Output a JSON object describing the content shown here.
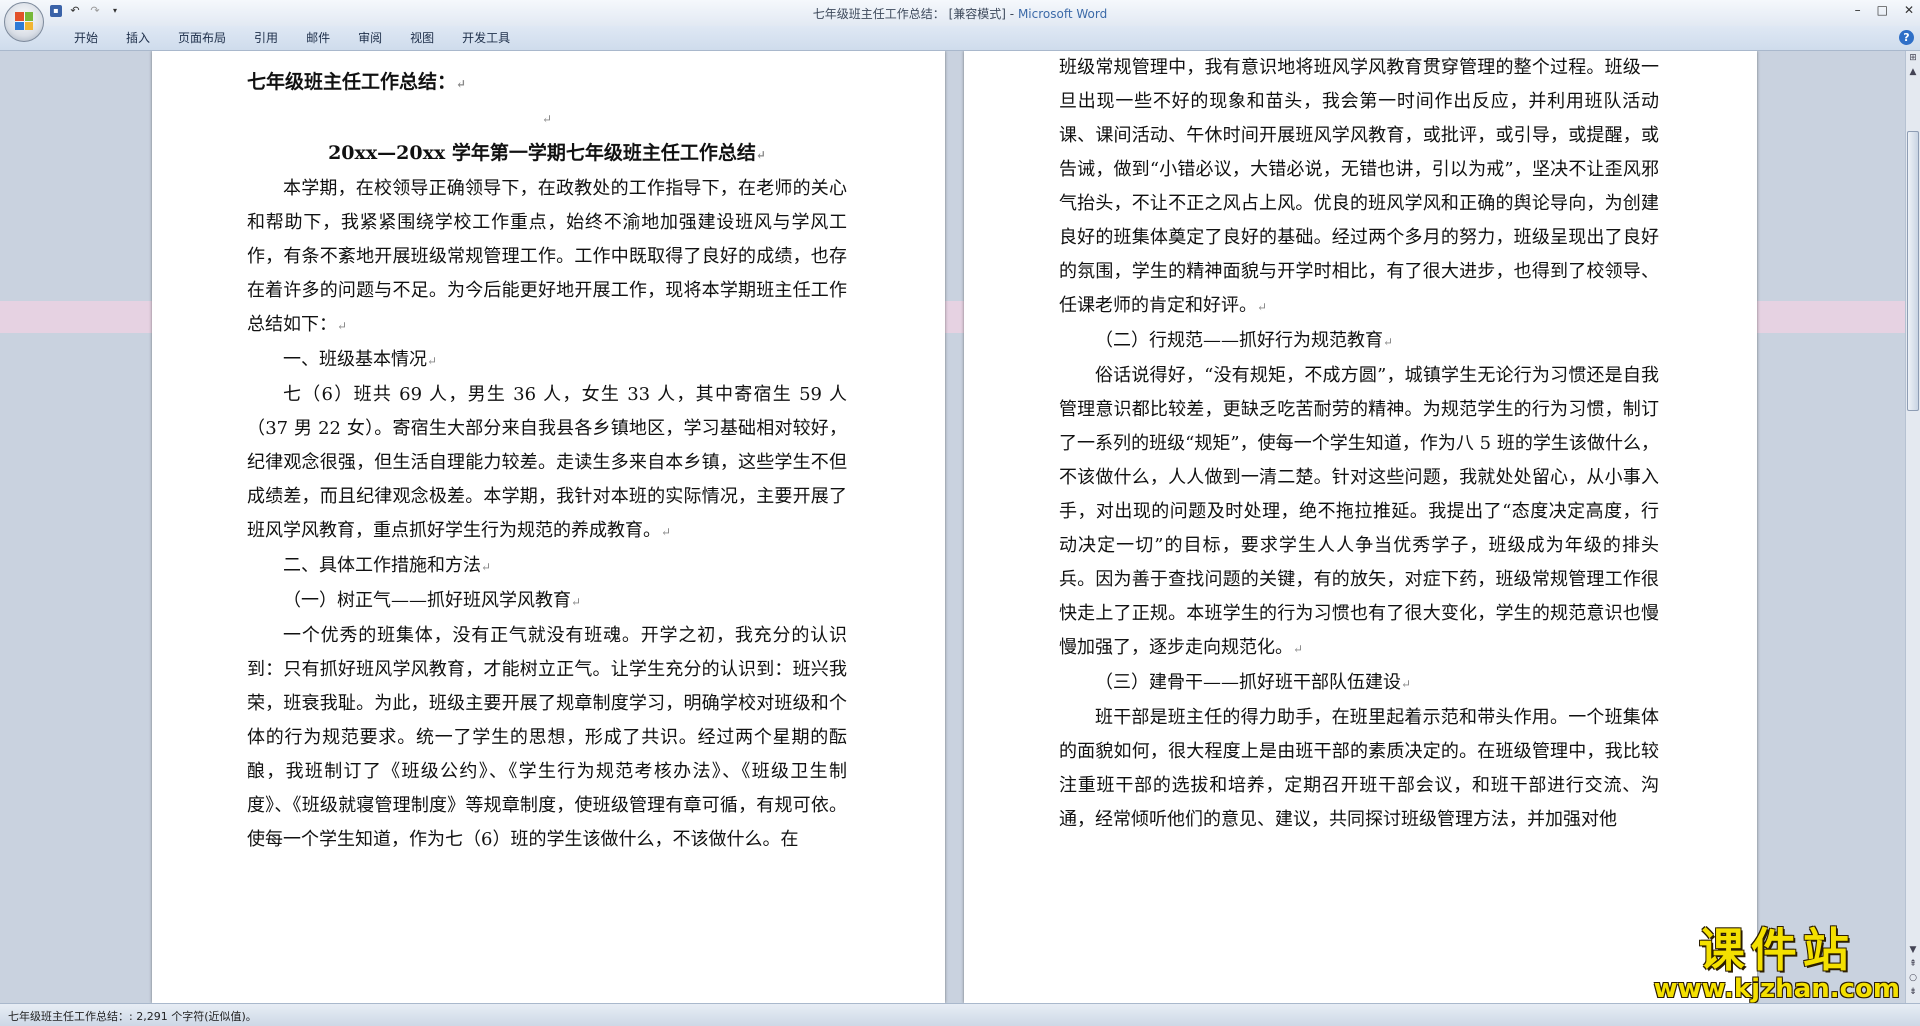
{
  "window": {
    "doc_title": "七年级班主任工作总结：",
    "mode": "[兼容模式]",
    "app": "Microsoft Word"
  },
  "ribbon": {
    "tabs": [
      "开始",
      "插入",
      "页面布局",
      "引用",
      "邮件",
      "审阅",
      "视图",
      "开发工具"
    ]
  },
  "page1": {
    "heading": "七年级班主任工作总结：",
    "title": "20xx—20xx 学年第一学期七年级班主任工作总结",
    "p1": "本学期，在校领导正确领导下，在政教处的工作指导下，在老师的关心和帮助下，我紧紧围绕学校工作重点，始终不渝地加强建设班风与学风工作，有条不紊地开展班级常规管理工作。工作中既取得了良好的成绩，也存在着许多的问题与不足。为今后能更好地开展工作，现将本学期班主任工作总结如下：",
    "s1": "一、班级基本情况",
    "p2": "七（6）班共 69 人，男生 36 人，女生 33 人，其中寄宿生 59 人（37 男 22 女）。寄宿生大部分来自我县各乡镇地区，学习基础相对较好，纪律观念很强，但生活自理能力较差。走读生多来自本乡镇，这些学生不但成绩差，而且纪律观念极差。本学期，我针对本班的实际情况，主要开展了班风学风教育，重点抓好学生行为规范的养成教育。",
    "s2": "二、具体工作措施和方法",
    "s3": "（一）树正气——抓好班风学风教育",
    "p3": "一个优秀的班集体，没有正气就没有班魂。开学之初，我充分的认识到：只有抓好班风学风教育，才能树立正气。让学生充分的认识到：班兴我荣，班衰我耻。为此，班级主要开展了规章制度学习，明确学校对班级和个体的行为规范要求。统一了学生的思想，形成了共识。经过两个星期的酝酿，我班制订了《班级公约》、《学生行为规范考核办法》、《班级卫生制度》、《班级就寝管理制度》等规章制度，使班级管理有章可循，有规可依。使每一个学生知道，作为七（6）班的学生该做什么，不该做什么。在"
  },
  "page2": {
    "p1": "班级常规管理中，我有意识地将班风学风教育贯穿管理的整个过程。班级一旦出现一些不好的现象和苗头，我会第一时间作出反应，并利用班队活动课、课间活动、午休时间开展班风学风教育，或批评，或引导，或提醒，或告诫，做到“小错必议，大错必说，无错也讲，引以为戒”，坚决不让歪风邪气抬头，不让不正之风占上风。优良的班风学风和正确的舆论导向，为创建良好的班集体奠定了良好的基础。经过两个多月的努力，班级呈现出了良好的氛围，学生的精神面貌与开学时相比，有了很大进步，也得到了校领导、任课老师的肯定和好评。",
    "s1": "（二）行规范——抓好行为规范教育",
    "p2": "俗话说得好，“没有规矩，不成方圆”，城镇学生无论行为习惯还是自我管理意识都比较差，更缺乏吃苦耐劳的精神。为规范学生的行为习惯，制订了一系列的班级“规矩”，使每一个学生知道，作为八 5 班的学生该做什么，不该做什么，人人做到一清二楚。针对这些问题，我就处处留心，从小事入手，对出现的问题及时处理，绝不拖拉推延。我提出了“态度决定高度，行动决定一切”的目标，要求学生人人争当优秀学子，班级成为年级的排头兵。因为善于查找问题的关键，有的放矢，对症下药，班级常规管理工作很快走上了正规。本班学生的行为习惯也有了很大变化，学生的规范意识也慢慢加强了，逐步走向规范化。",
    "s2": "（三）建骨干——抓好班干部队伍建设",
    "p3": "班干部是班主任的得力助手，在班里起着示范和带头作用。一个班集体的面貌如何，很大程度上是由班干部的素质决定的。在班级管理中，我比较注重班干部的选拔和培养，定期召开班干部会议，和班干部进行交流、沟通，经常倾听他们的意见、建议，共同探讨班级管理方法，并加强对他"
  },
  "status": {
    "text": "七年级班主任工作总结：: 2,291 个字符(近似值)。"
  },
  "watermark": {
    "main": "课件站",
    "url": "www.kjzhan.com"
  },
  "icons": {
    "paragraph_mark": "↵"
  }
}
